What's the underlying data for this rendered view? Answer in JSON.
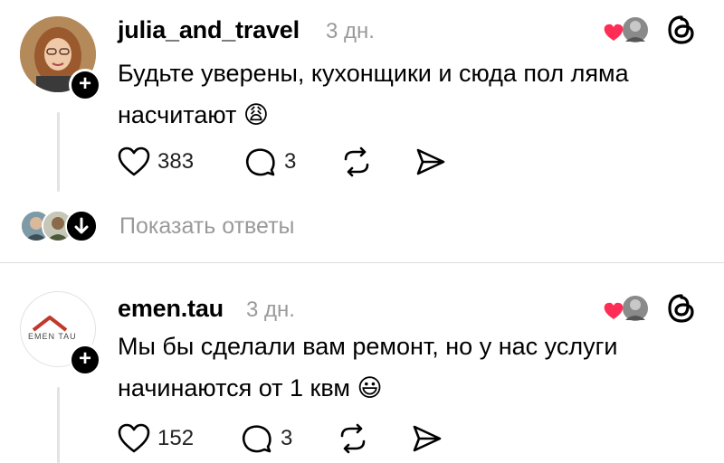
{
  "posts": [
    {
      "username": "julia_and_travel",
      "time": "3 дн.",
      "text": "Будьте уверены, кухонщики и сюда пол ляма насчитают",
      "emoji": "😩",
      "likes": "383",
      "replies": "3",
      "avatar": "avatar-woman",
      "show_replies": "Показать ответы"
    },
    {
      "username": "emen.tau",
      "time": "3 дн.",
      "text": "Мы бы сделали вам ремонт, но у нас услуги начинаются от 1 квм",
      "emoji": "😃",
      "likes": "152",
      "replies": "3",
      "avatar_logo_text": "EMEN TAU"
    }
  ],
  "icons": [
    "heart-icon",
    "comment-icon",
    "repost-icon",
    "share-icon",
    "threads-icon",
    "follow-plus-icon",
    "chevron-down-icon"
  ],
  "colors": {
    "accent_heart": "#ff2d55",
    "muted": "#9a9a9a",
    "logo_red": "#c0392b"
  }
}
